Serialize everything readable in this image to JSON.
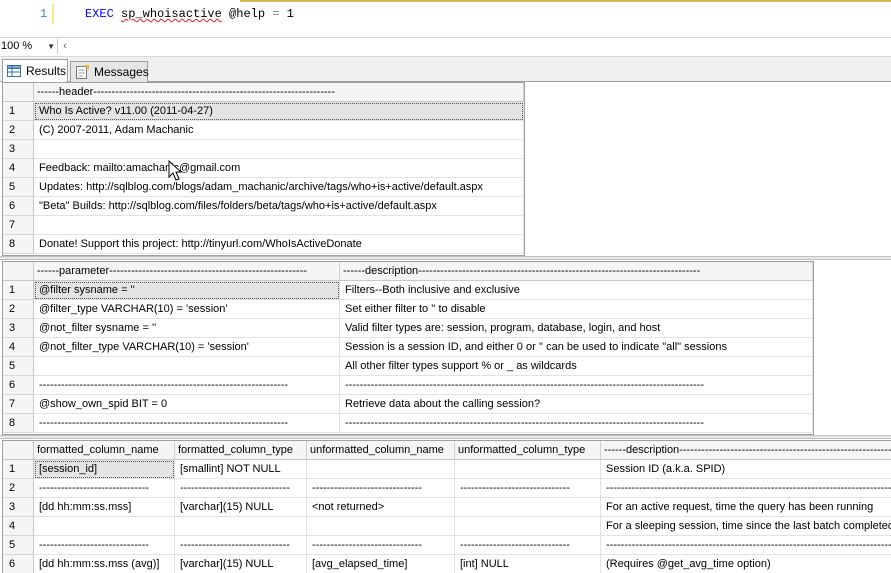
{
  "editor": {
    "line_number": "1",
    "keyword": "EXEC",
    "proc_name": "sp_whoisactive",
    "param": "@help",
    "operator": "=",
    "value": "1"
  },
  "zoom": {
    "level": "100 %"
  },
  "tabs": [
    {
      "label": "Results",
      "icon": "grid-icon",
      "active": true
    },
    {
      "label": "Messages",
      "icon": "messages-icon",
      "active": false
    }
  ],
  "grid1": {
    "columns": [
      "------header------------------------------------------------------------------"
    ],
    "rows": [
      [
        "1",
        "Who Is Active? v11.00 (2011-04-27)"
      ],
      [
        "2",
        "(C) 2007-2011, Adam Machanic"
      ],
      [
        "3",
        ""
      ],
      [
        "4",
        "Feedback: mailto:amachanic@gmail.com"
      ],
      [
        "5",
        "Updates: http://sqlblog.com/blogs/adam_machanic/archive/tags/who+is+active/default.aspx"
      ],
      [
        "6",
        "\"Beta\" Builds: http://sqlblog.com/files/folders/beta/tags/who+is+active/default.aspx"
      ],
      [
        "7",
        ""
      ],
      [
        "8",
        "Donate! Support this project: http://tinyurl.com/WhoIsActiveDonate"
      ]
    ]
  },
  "grid2": {
    "columns": [
      "------parameter------------------------------------------------------",
      "------description-----------------------------------------------------------------------------"
    ],
    "rows": [
      [
        "1",
        "@filter sysname = ''",
        "Filters--Both inclusive and exclusive"
      ],
      [
        "2",
        "@filter_type VARCHAR(10) = 'session'",
        "Set either filter to '' to disable"
      ],
      [
        "3",
        "@not_filter sysname = ''",
        "Valid filter types are: session, program, database, login, and host"
      ],
      [
        "4",
        "@not_filter_type VARCHAR(10) = 'session'",
        "Session is a session ID, and either 0 or '' can be used to indicate \"all\" sessions"
      ],
      [
        "5",
        "",
        "All other filter types support % or _ as wildcards"
      ],
      [
        "6",
        "--------------------------------------------------------------------",
        "--------------------------------------------------------------------------------------------------"
      ],
      [
        "7",
        "@show_own_spid BIT = 0",
        "Retrieve data about the calling session?"
      ],
      [
        "8",
        "--------------------------------------------------------------------",
        "--------------------------------------------------------------------------------------------------"
      ]
    ]
  },
  "grid3": {
    "columns": [
      "formatted_column_name",
      "formatted_column_type",
      "unformatted_column_name",
      "unformatted_column_type",
      "------description-----------------------------------------------------------------"
    ],
    "rows": [
      [
        "1",
        "[session_id]",
        "[smallint] NOT NULL",
        "",
        "",
        "Session ID (a.k.a. SPID)"
      ],
      [
        "2",
        "------------------------------",
        "------------------------------",
        "------------------------------",
        "------------------------------",
        "----------------------------------------------------------------------------------------"
      ],
      [
        "3",
        "[dd hh:mm:ss.mss]",
        "[varchar](15) NULL",
        "<not returned>",
        "",
        "For an active request, time the query has been running"
      ],
      [
        "4",
        "",
        "",
        "",
        "",
        "For a sleeping session, time since the last batch completed"
      ],
      [
        "5",
        "------------------------------",
        "------------------------------",
        "------------------------------",
        "------------------------------",
        "----------------------------------------------------------------------------------------"
      ],
      [
        "6",
        "[dd hh:mm:ss.mss (avg)]",
        "[varchar](15) NULL",
        "[avg_elapsed_time]",
        "[int] NULL",
        "(Requires @get_avg_time option)"
      ]
    ]
  }
}
